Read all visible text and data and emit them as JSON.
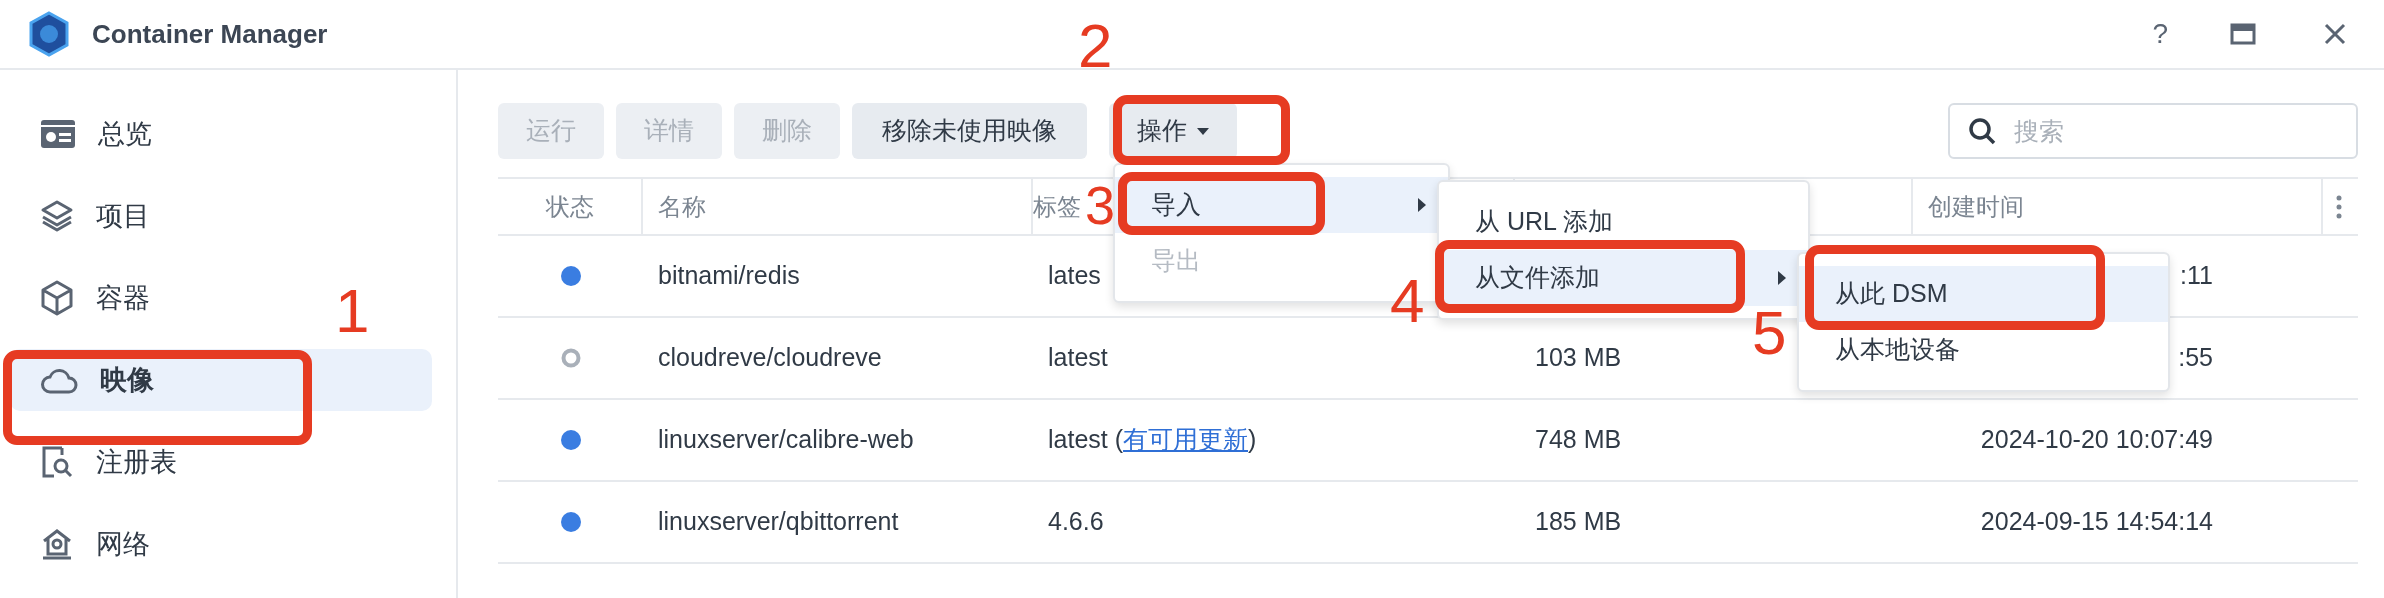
{
  "window": {
    "title": "Container Manager",
    "help": "?"
  },
  "sidebar": {
    "items": [
      {
        "label": "总览",
        "selected": false
      },
      {
        "label": "项目",
        "selected": false
      },
      {
        "label": "容器",
        "selected": false
      },
      {
        "label": "映像",
        "selected": true
      },
      {
        "label": "注册表",
        "selected": false
      },
      {
        "label": "网络",
        "selected": false
      }
    ]
  },
  "toolbar": {
    "buttons": [
      {
        "label": "运行",
        "disabled": true
      },
      {
        "label": "详情",
        "disabled": true
      },
      {
        "label": "删除",
        "disabled": true
      },
      {
        "label": "移除未使用映像",
        "disabled": false
      }
    ],
    "action_button": {
      "label": "操作"
    },
    "search": {
      "placeholder": "搜索"
    }
  },
  "table": {
    "columns": [
      "状态",
      "名称",
      "标签",
      "创建时间"
    ],
    "rows": [
      {
        "active": true,
        "name": "bitnami/redis",
        "tag": "lates",
        "created": ":11"
      },
      {
        "active": false,
        "name": "cloudreve/cloudreve",
        "tag": "latest",
        "size": "103 MB",
        "created": ":55"
      },
      {
        "active": true,
        "name": "linuxserver/calibre-web",
        "tag": "latest (",
        "tag_link": "有可用更新",
        "tag_after": ")",
        "size": "748 MB",
        "created": "2024-10-20 10:07:49"
      },
      {
        "active": true,
        "name": "linuxserver/qbittorrent",
        "tag": "4.6.6",
        "size": "185 MB",
        "created": "2024-09-15 14:54:14"
      }
    ]
  },
  "menus": [
    {
      "items": [
        {
          "label": "导入",
          "selected": true,
          "disabled": false,
          "submenu": true
        },
        {
          "label": "导出",
          "selected": false,
          "disabled": true,
          "submenu": false
        }
      ]
    },
    {
      "items": [
        {
          "label": "从 URL 添加",
          "selected": false,
          "disabled": false,
          "submenu": false
        },
        {
          "label": "从文件添加",
          "selected": true,
          "disabled": false,
          "submenu": true
        }
      ]
    },
    {
      "items": [
        {
          "label": "从此 DSM",
          "selected": true,
          "disabled": false,
          "submenu": false
        },
        {
          "label": "从本地设备",
          "selected": false,
          "disabled": false,
          "submenu": false
        }
      ]
    }
  ],
  "annotations": [
    {
      "number": "1"
    },
    {
      "number": "2"
    },
    {
      "number": "3"
    },
    {
      "number": "4"
    },
    {
      "number": "5"
    }
  ]
}
